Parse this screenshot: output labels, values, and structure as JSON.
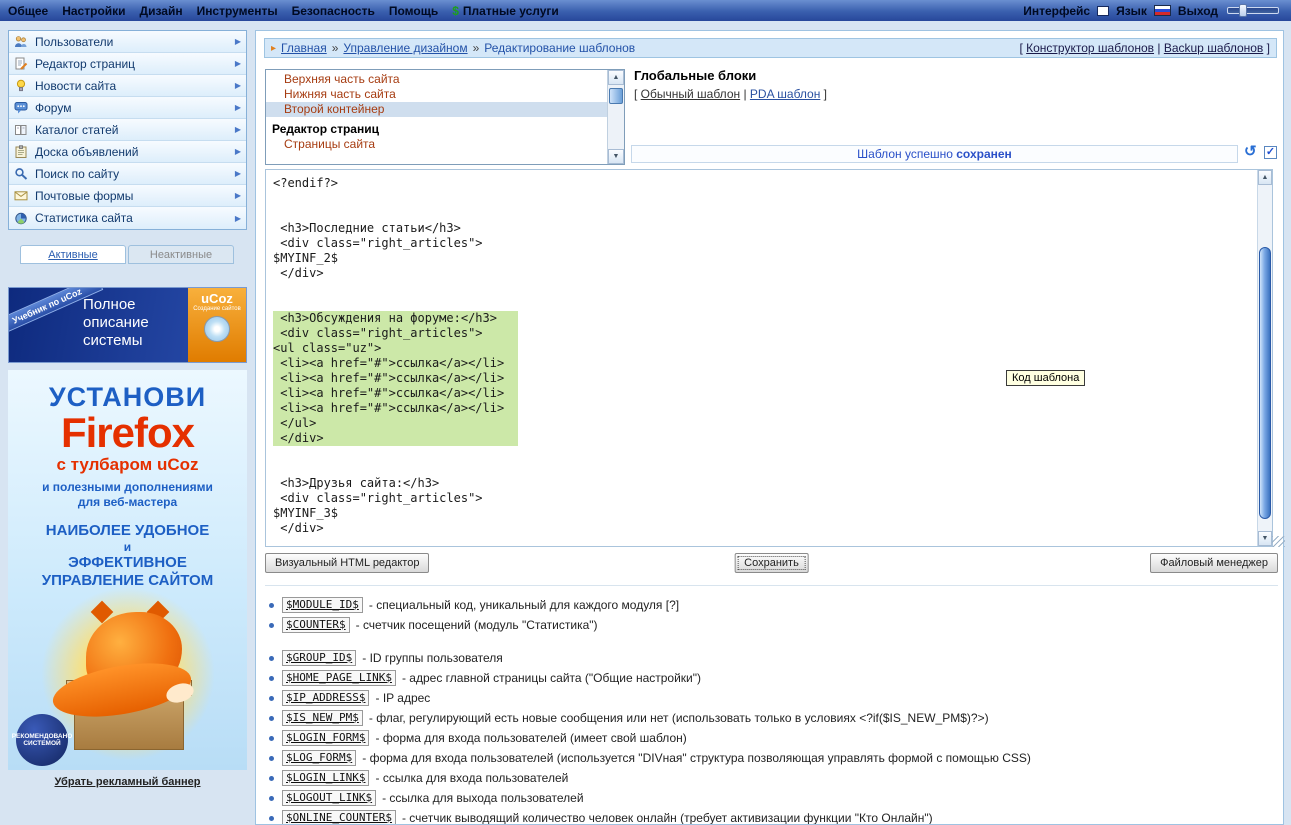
{
  "colors": {
    "topbar_blue": "#3a5fae",
    "link_blue": "#2352a8",
    "template_link_red": "#a63c11",
    "selection_green": "#cce8a8",
    "status_blue": "#2a50c8",
    "paid_green": "#1d9e1d"
  },
  "topbar": {
    "menu": [
      "Общее",
      "Настройки",
      "Дизайн",
      "Инструменты",
      "Безопасность",
      "Помощь"
    ],
    "menu_slugs": [
      "general",
      "settings",
      "design",
      "tools",
      "security",
      "help"
    ],
    "paid": "Платные услуги",
    "dollar": "$",
    "interface_label": "Интерфейс",
    "language_label": "Язык",
    "logout_label": "Выход"
  },
  "sidebar": {
    "items": [
      {
        "icon": "users-icon",
        "label": "Пользователи"
      },
      {
        "icon": "page-editor-icon",
        "label": "Редактор страниц"
      },
      {
        "icon": "news-icon",
        "label": "Новости сайта"
      },
      {
        "icon": "forum-icon",
        "label": "Форум"
      },
      {
        "icon": "articles-icon",
        "label": "Каталог статей"
      },
      {
        "icon": "board-icon",
        "label": "Доска объявлений"
      },
      {
        "icon": "search-icon",
        "label": "Поиск по сайту"
      },
      {
        "icon": "mail-icon",
        "label": "Почтовые формы"
      },
      {
        "icon": "stats-icon",
        "label": "Статистика сайта"
      }
    ],
    "tabs": {
      "active": "Активные",
      "inactive": "Неактивные"
    },
    "banner_book": {
      "ribbon": "Учебник по uCoz",
      "line1": "Полное",
      "line2": "описание",
      "line3": "системы",
      "logo": "uCoz",
      "logo_sub": "Создание сайтов"
    },
    "banner_firefox": {
      "line1": "УСТАНОВИ",
      "line2": "Firefox",
      "line3": "с тулбаром uCoz",
      "line4": "и полезными дополнениями",
      "line5": "для веб-мастера",
      "line6": "НАИБОЛЕЕ УДОБНОЕ",
      "line7": "и",
      "line8": "ЭФФЕКТИВНОЕ",
      "line9": "УПРАВЛЕНИЕ САЙТОМ",
      "badge": "РЕКОМЕНДОВАНО СИСТЕМОЙ"
    },
    "remove_banner": "Убрать рекламный баннер"
  },
  "breadcrumb": {
    "home": "Главная",
    "sep": "»",
    "design": "Управление дизайном",
    "current": "Редактирование шаблонов",
    "r_open": "[",
    "right_link1": "Конструктор шаблонов",
    "r_div": "|",
    "right_link2": "Backup шаблонов",
    "r_close": "]"
  },
  "template_list": {
    "items": [
      {
        "label": "Верхняя часть сайта",
        "type": "link"
      },
      {
        "label": "Нижняя часть сайта",
        "type": "link"
      },
      {
        "label": "Второй контейнер",
        "type": "link selected"
      },
      {
        "label": "Редактор страниц",
        "type": "section"
      },
      {
        "label": "Страницы сайта",
        "type": "link"
      }
    ]
  },
  "global_blocks": {
    "title": "Глобальные блоки",
    "open": "[ ",
    "normal": "Обычный шаблон",
    "divider": " | ",
    "pda": "PDA шаблон",
    "close": " ]"
  },
  "status": {
    "text": "Шаблон успешно ",
    "bold": "сохранен"
  },
  "editor": {
    "code_before": "<?endif?>\n\n\n <h3>Последние статьи</h3>\n <div class=\"right_articles\">\n$MYINF_2$\n </div>\n\n\n",
    "code_selected": " <h3>Обсуждения на форуме:</h3>\n <div class=\"right_articles\">\n<ul class=\"uz\">\n <li><a href=\"#\">ссылка</a></li>\n <li><a href=\"#\">ссылка</a></li>\n <li><a href=\"#\">ссылка</a></li>\n <li><a href=\"#\">ссылка</a></li>\n </ul>\n </div>",
    "code_after": "\n\n\n <h3>Друзья сайта:</h3>\n <div class=\"right_articles\">\n$MYINF_3$\n </div>\n",
    "tooltip": "Код шаблона"
  },
  "buttons": {
    "visual": "Визуальный HTML редактор",
    "save": "Сохранить",
    "files": "Файловый менеджер"
  },
  "variables": [
    {
      "code": "$MODULE_ID$",
      "desc": "- специальный код, уникальный для каждого модуля  [?]"
    },
    {
      "code": "$COUNTER$",
      "desc": "- счетчик посещений (модуль \"Статистика\")",
      "gap_after": true
    },
    {
      "code": "$GROUP_ID$",
      "desc": "- ID группы пользователя"
    },
    {
      "code": "$HOME_PAGE_LINK$",
      "desc": "- адрес главной страницы сайта (\"Общие настройки\")"
    },
    {
      "code": "$IP_ADDRESS$",
      "desc": "- IP адрес"
    },
    {
      "code": "$IS_NEW_PM$",
      "desc": "- флаг, регулирующий есть новые сообщения или нет (использовать только в условиях <?if($IS_NEW_PM$)?>)"
    },
    {
      "code": "$LOGIN_FORM$",
      "desc": "- форма для входа пользователей (имеет свой шаблон)"
    },
    {
      "code": "$LOG_FORM$",
      "desc": "- форма для входа пользователей (используется \"DIVная\" структура позволяющая управлять формой с помощью CSS)"
    },
    {
      "code": "$LOGIN_LINK$",
      "desc": "- ссылка для входа пользователей"
    },
    {
      "code": "$LOGOUT_LINK$",
      "desc": "- ссылка для выхода пользователей"
    },
    {
      "code": "$ONLINE_COUNTER$",
      "desc": "- счетчик выводящий количество человек онлайн (требует активизации функции \"Кто Онлайн\")"
    }
  ]
}
